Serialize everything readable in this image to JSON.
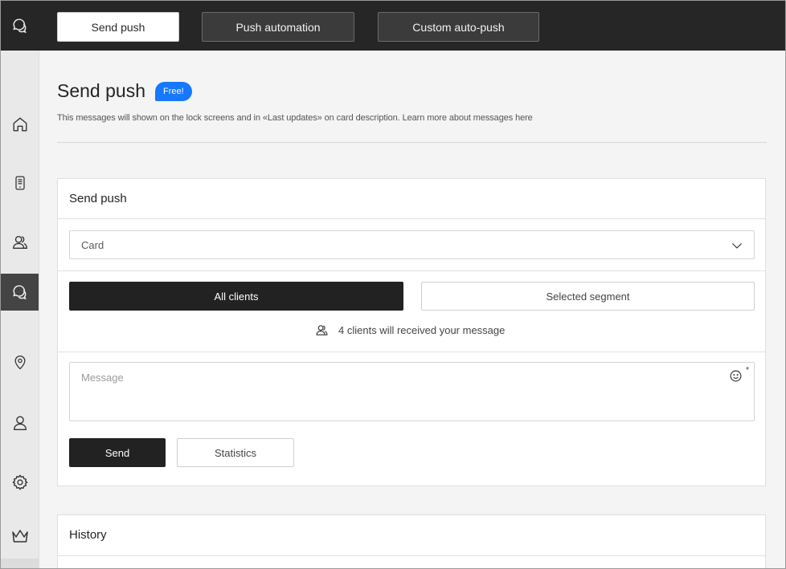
{
  "topbar": {
    "logo_icon": "chat-bubbles-icon",
    "tabs": [
      {
        "label": "Send push",
        "active": true
      },
      {
        "label": "Push automation",
        "active": false
      },
      {
        "label": "Custom auto-push",
        "active": false
      }
    ]
  },
  "sidebar": {
    "items": [
      {
        "icon": "home-icon",
        "active": false
      },
      {
        "icon": "card-device-icon",
        "active": false
      },
      {
        "icon": "clients-icon",
        "active": false
      },
      {
        "icon": "chat-bubbles-icon",
        "active": true
      },
      {
        "icon": "location-pin-icon",
        "active": false
      },
      {
        "icon": "user-icon",
        "active": false
      },
      {
        "icon": "gear-icon",
        "active": false
      },
      {
        "icon": "crown-icon",
        "active": false
      }
    ]
  },
  "page": {
    "title": "Send push",
    "badge": "Free!",
    "description": "This messages will shown on the lock screens and in «Last updates» on card description. Learn more about messages here"
  },
  "send_card": {
    "title": "Send push",
    "select": {
      "value": "Card",
      "icon": "chevron-down-icon"
    },
    "segments": {
      "all": "All clients",
      "selected": "Selected segment"
    },
    "recipients_text": "4 clients will received your message",
    "message": {
      "placeholder": "Message",
      "required_mark": "*",
      "emoji_icon": "smiley-icon"
    },
    "send_label": "Send",
    "statistics_label": "Statistics"
  },
  "history_card": {
    "title": "History"
  },
  "colors": {
    "topbar": "#262626",
    "sidebar": "#e9e9e9",
    "sidebar_active": "#444444",
    "page_bg": "#f4f4f4",
    "primary_button": "#222222",
    "badge": "#1677ff"
  }
}
